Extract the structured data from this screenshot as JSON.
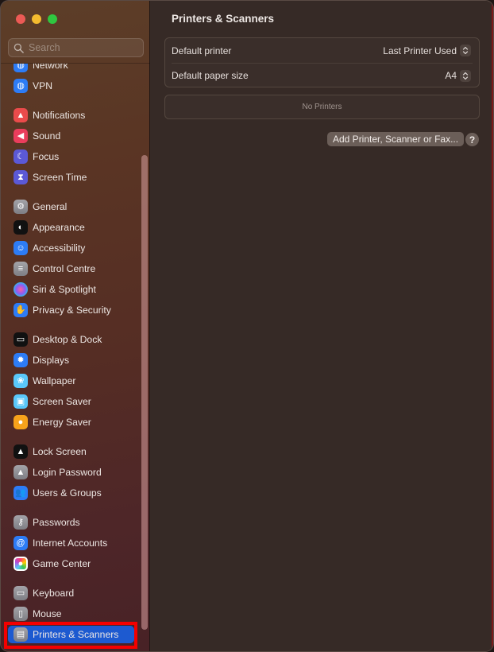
{
  "window": {
    "traffic_lights": [
      "close",
      "minimize",
      "zoom"
    ]
  },
  "sidebar": {
    "search": {
      "placeholder": "Search",
      "value": ""
    },
    "groups": [
      [
        {
          "label": "Network",
          "icon": "network-icon",
          "color": "#2d7cf6"
        },
        {
          "label": "VPN",
          "icon": "vpn-icon",
          "color": "#2d7cf6"
        }
      ],
      [
        {
          "label": "Notifications",
          "icon": "notifications-icon",
          "color": "#ea4b4b"
        },
        {
          "label": "Sound",
          "icon": "sound-icon",
          "color": "#ea3d5c"
        },
        {
          "label": "Focus",
          "icon": "focus-icon",
          "color": "#5b59d6"
        },
        {
          "label": "Screen Time",
          "icon": "screen-time-icon",
          "color": "#5b59d6"
        }
      ],
      [
        {
          "label": "General",
          "icon": "gear-icon",
          "color": "#8e8e93"
        },
        {
          "label": "Appearance",
          "icon": "appearance-icon",
          "color": "#111111"
        },
        {
          "label": "Accessibility",
          "icon": "accessibility-icon",
          "color": "#2d7cf6"
        },
        {
          "label": "Control Centre",
          "icon": "control-centre-icon",
          "color": "#8e8e93"
        },
        {
          "label": "Siri & Spotlight",
          "icon": "siri-icon",
          "color": "#3b2a6a"
        },
        {
          "label": "Privacy & Security",
          "icon": "hand-icon",
          "color": "#2d7cf6"
        }
      ],
      [
        {
          "label": "Desktop & Dock",
          "icon": "dock-icon",
          "color": "#111111"
        },
        {
          "label": "Displays",
          "icon": "displays-icon",
          "color": "#2d7cf6"
        },
        {
          "label": "Wallpaper",
          "icon": "wallpaper-icon",
          "color": "#5ac8fa"
        },
        {
          "label": "Screen Saver",
          "icon": "screen-saver-icon",
          "color": "#5ac8fa"
        },
        {
          "label": "Energy Saver",
          "icon": "lightbulb-icon",
          "color": "#f7a21b"
        }
      ],
      [
        {
          "label": "Lock Screen",
          "icon": "lock-screen-icon",
          "color": "#111111"
        },
        {
          "label": "Login Password",
          "icon": "lock-icon",
          "color": "#8e8e93"
        },
        {
          "label": "Users & Groups",
          "icon": "users-icon",
          "color": "#2d7cf6"
        }
      ],
      [
        {
          "label": "Passwords",
          "icon": "key-icon",
          "color": "#8e8e93"
        },
        {
          "label": "Internet Accounts",
          "icon": "at-icon",
          "color": "#2d7cf6"
        },
        {
          "label": "Game Center",
          "icon": "game-center-icon",
          "color": "#ffffff"
        }
      ],
      [
        {
          "label": "Keyboard",
          "icon": "keyboard-icon",
          "color": "#8e8e93"
        },
        {
          "label": "Mouse",
          "icon": "mouse-icon",
          "color": "#8e8e93"
        },
        {
          "label": "Printers & Scanners",
          "icon": "printer-icon",
          "color": "#8e8e93",
          "selected": true
        }
      ]
    ]
  },
  "main": {
    "title": "Printers & Scanners",
    "settings": [
      {
        "label": "Default printer",
        "value": "Last Printer Used"
      },
      {
        "label": "Default paper size",
        "value": "A4"
      }
    ],
    "printers_empty_text": "No Printers",
    "add_button_label": "Add Printer, Scanner or Fax...",
    "help_label": "?"
  },
  "colors": {
    "selection": "#1d5ad0",
    "highlight_box": "#f40000"
  }
}
